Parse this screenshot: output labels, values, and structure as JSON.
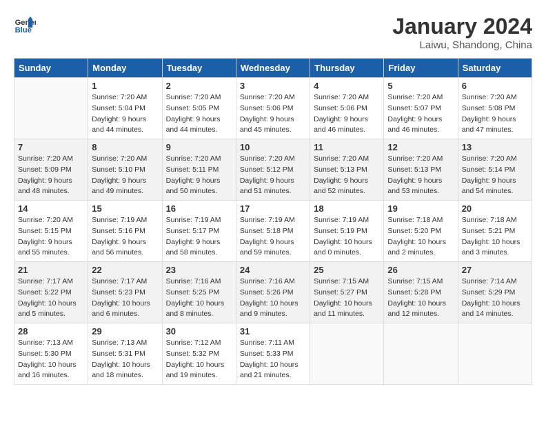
{
  "header": {
    "logo_line1": "General",
    "logo_line2": "Blue",
    "month": "January 2024",
    "location": "Laiwu, Shandong, China"
  },
  "weekdays": [
    "Sunday",
    "Monday",
    "Tuesday",
    "Wednesday",
    "Thursday",
    "Friday",
    "Saturday"
  ],
  "weeks": [
    [
      {
        "day": "",
        "info": ""
      },
      {
        "day": "1",
        "info": "Sunrise: 7:20 AM\nSunset: 5:04 PM\nDaylight: 9 hours\nand 44 minutes."
      },
      {
        "day": "2",
        "info": "Sunrise: 7:20 AM\nSunset: 5:05 PM\nDaylight: 9 hours\nand 44 minutes."
      },
      {
        "day": "3",
        "info": "Sunrise: 7:20 AM\nSunset: 5:06 PM\nDaylight: 9 hours\nand 45 minutes."
      },
      {
        "day": "4",
        "info": "Sunrise: 7:20 AM\nSunset: 5:06 PM\nDaylight: 9 hours\nand 46 minutes."
      },
      {
        "day": "5",
        "info": "Sunrise: 7:20 AM\nSunset: 5:07 PM\nDaylight: 9 hours\nand 46 minutes."
      },
      {
        "day": "6",
        "info": "Sunrise: 7:20 AM\nSunset: 5:08 PM\nDaylight: 9 hours\nand 47 minutes."
      }
    ],
    [
      {
        "day": "7",
        "info": "Sunrise: 7:20 AM\nSunset: 5:09 PM\nDaylight: 9 hours\nand 48 minutes."
      },
      {
        "day": "8",
        "info": "Sunrise: 7:20 AM\nSunset: 5:10 PM\nDaylight: 9 hours\nand 49 minutes."
      },
      {
        "day": "9",
        "info": "Sunrise: 7:20 AM\nSunset: 5:11 PM\nDaylight: 9 hours\nand 50 minutes."
      },
      {
        "day": "10",
        "info": "Sunrise: 7:20 AM\nSunset: 5:12 PM\nDaylight: 9 hours\nand 51 minutes."
      },
      {
        "day": "11",
        "info": "Sunrise: 7:20 AM\nSunset: 5:13 PM\nDaylight: 9 hours\nand 52 minutes."
      },
      {
        "day": "12",
        "info": "Sunrise: 7:20 AM\nSunset: 5:13 PM\nDaylight: 9 hours\nand 53 minutes."
      },
      {
        "day": "13",
        "info": "Sunrise: 7:20 AM\nSunset: 5:14 PM\nDaylight: 9 hours\nand 54 minutes."
      }
    ],
    [
      {
        "day": "14",
        "info": "Sunrise: 7:20 AM\nSunset: 5:15 PM\nDaylight: 9 hours\nand 55 minutes."
      },
      {
        "day": "15",
        "info": "Sunrise: 7:19 AM\nSunset: 5:16 PM\nDaylight: 9 hours\nand 56 minutes."
      },
      {
        "day": "16",
        "info": "Sunrise: 7:19 AM\nSunset: 5:17 PM\nDaylight: 9 hours\nand 58 minutes."
      },
      {
        "day": "17",
        "info": "Sunrise: 7:19 AM\nSunset: 5:18 PM\nDaylight: 9 hours\nand 59 minutes."
      },
      {
        "day": "18",
        "info": "Sunrise: 7:19 AM\nSunset: 5:19 PM\nDaylight: 10 hours\nand 0 minutes."
      },
      {
        "day": "19",
        "info": "Sunrise: 7:18 AM\nSunset: 5:20 PM\nDaylight: 10 hours\nand 2 minutes."
      },
      {
        "day": "20",
        "info": "Sunrise: 7:18 AM\nSunset: 5:21 PM\nDaylight: 10 hours\nand 3 minutes."
      }
    ],
    [
      {
        "day": "21",
        "info": "Sunrise: 7:17 AM\nSunset: 5:22 PM\nDaylight: 10 hours\nand 5 minutes."
      },
      {
        "day": "22",
        "info": "Sunrise: 7:17 AM\nSunset: 5:23 PM\nDaylight: 10 hours\nand 6 minutes."
      },
      {
        "day": "23",
        "info": "Sunrise: 7:16 AM\nSunset: 5:25 PM\nDaylight: 10 hours\nand 8 minutes."
      },
      {
        "day": "24",
        "info": "Sunrise: 7:16 AM\nSunset: 5:26 PM\nDaylight: 10 hours\nand 9 minutes."
      },
      {
        "day": "25",
        "info": "Sunrise: 7:15 AM\nSunset: 5:27 PM\nDaylight: 10 hours\nand 11 minutes."
      },
      {
        "day": "26",
        "info": "Sunrise: 7:15 AM\nSunset: 5:28 PM\nDaylight: 10 hours\nand 12 minutes."
      },
      {
        "day": "27",
        "info": "Sunrise: 7:14 AM\nSunset: 5:29 PM\nDaylight: 10 hours\nand 14 minutes."
      }
    ],
    [
      {
        "day": "28",
        "info": "Sunrise: 7:13 AM\nSunset: 5:30 PM\nDaylight: 10 hours\nand 16 minutes."
      },
      {
        "day": "29",
        "info": "Sunrise: 7:13 AM\nSunset: 5:31 PM\nDaylight: 10 hours\nand 18 minutes."
      },
      {
        "day": "30",
        "info": "Sunrise: 7:12 AM\nSunset: 5:32 PM\nDaylight: 10 hours\nand 19 minutes."
      },
      {
        "day": "31",
        "info": "Sunrise: 7:11 AM\nSunset: 5:33 PM\nDaylight: 10 hours\nand 21 minutes."
      },
      {
        "day": "",
        "info": ""
      },
      {
        "day": "",
        "info": ""
      },
      {
        "day": "",
        "info": ""
      }
    ]
  ]
}
